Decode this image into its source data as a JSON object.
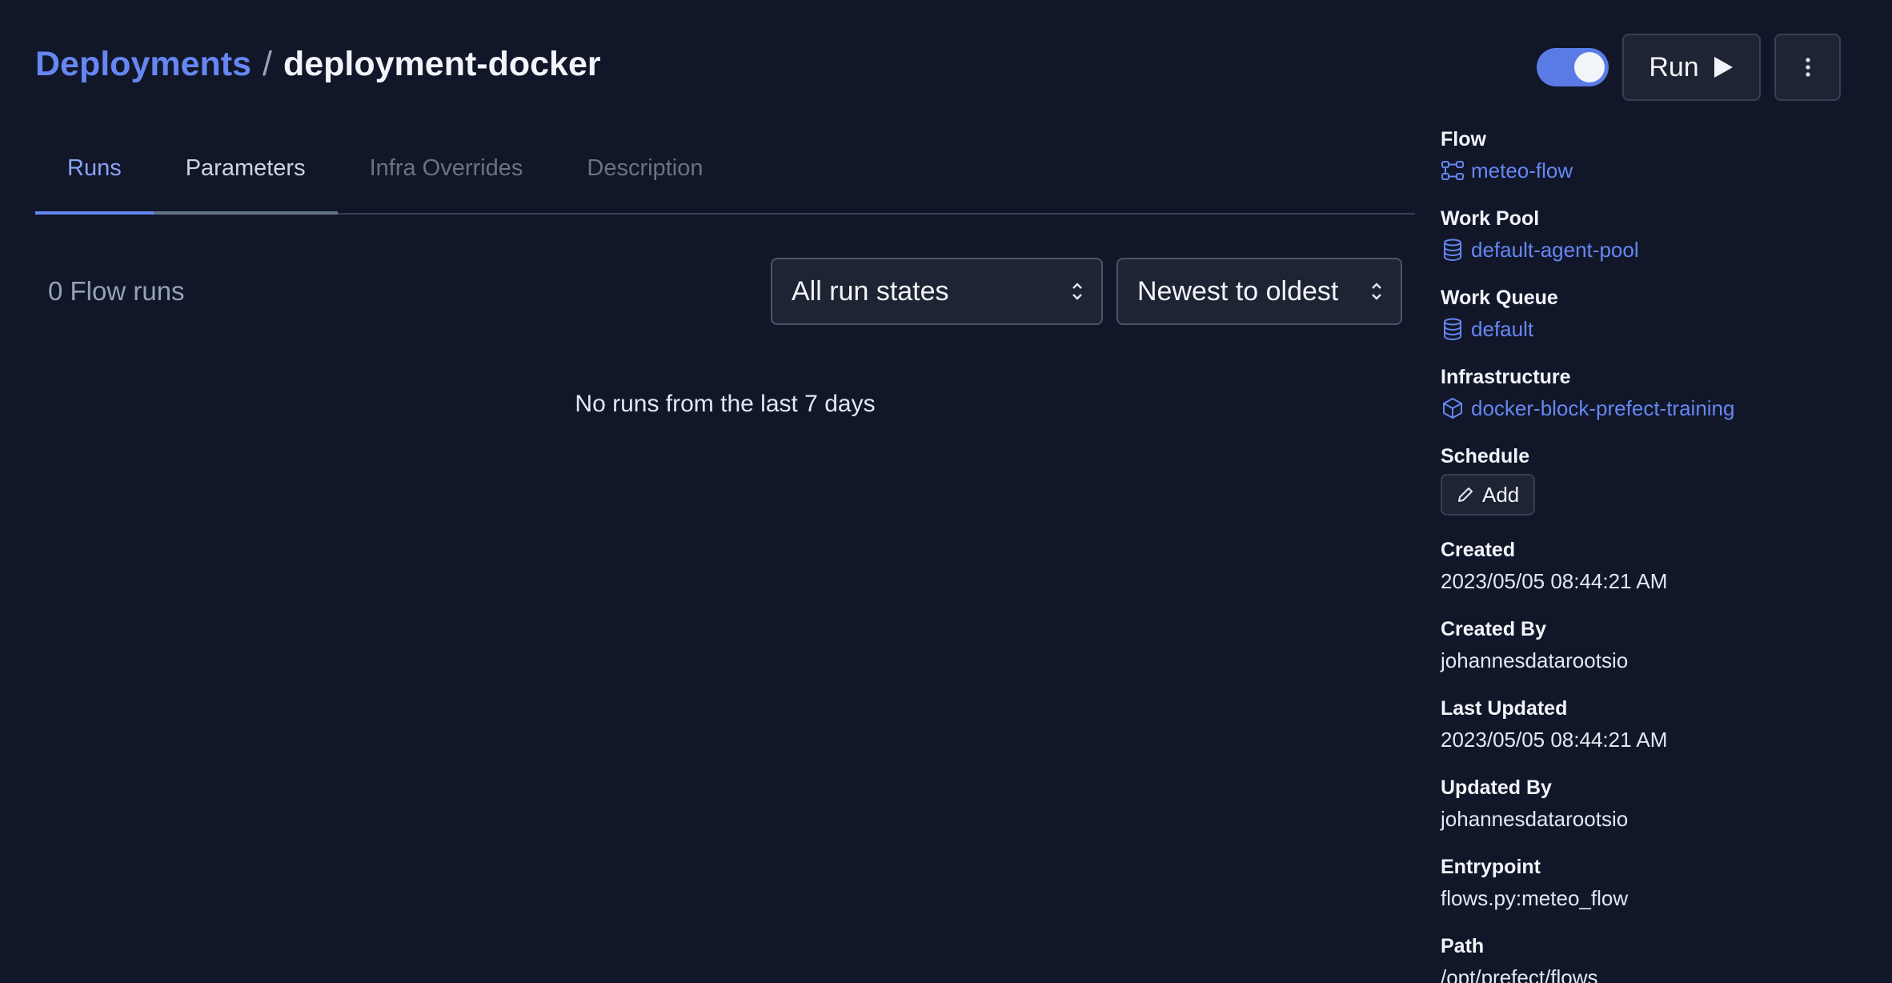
{
  "header": {
    "breadcrumb_parent": "Deployments",
    "breadcrumb_separator": "/",
    "breadcrumb_current": "deployment-docker",
    "toggle_on": true,
    "run_label": "Run"
  },
  "tabs": [
    {
      "label": "Runs",
      "state": "active"
    },
    {
      "label": "Parameters",
      "state": "hover"
    },
    {
      "label": "Infra Overrides",
      "state": "inactive"
    },
    {
      "label": "Description",
      "state": "inactive"
    }
  ],
  "runs": {
    "count_text": "0 Flow runs",
    "state_filter": "All run states",
    "sort": "Newest to oldest",
    "empty_message": "No runs from the last 7 days"
  },
  "details": {
    "flow_label": "Flow",
    "flow_value": "meteo-flow",
    "work_pool_label": "Work Pool",
    "work_pool_value": "default-agent-pool",
    "work_queue_label": "Work Queue",
    "work_queue_value": "default",
    "infrastructure_label": "Infrastructure",
    "infrastructure_value": "docker-block-prefect-training",
    "schedule_label": "Schedule",
    "schedule_add": "Add",
    "created_label": "Created",
    "created_value": "2023/05/05 08:44:21 AM",
    "created_by_label": "Created By",
    "created_by_value": "johannesdatarootsio",
    "last_updated_label": "Last Updated",
    "last_updated_value": "2023/05/05 08:44:21 AM",
    "updated_by_label": "Updated By",
    "updated_by_value": "johannesdatarootsio",
    "entrypoint_label": "Entrypoint",
    "entrypoint_value": "flows.py:meteo_flow",
    "path_label": "Path",
    "path_value": "/opt/prefect/flows"
  },
  "colors": {
    "background": "#111729",
    "accent": "#6687f2",
    "panel": "#1e2433"
  }
}
